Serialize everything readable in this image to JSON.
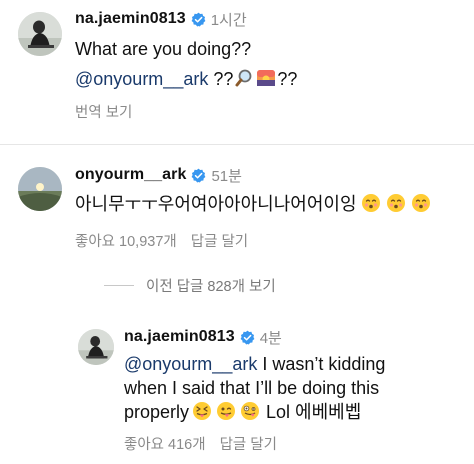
{
  "comment1": {
    "username": "na.jaemin0813",
    "time": "1시간",
    "line1": "What are you doing??",
    "mention": "@onyourm__ark",
    "line2_suffix_a": " ??",
    "line2_suffix_b": "??",
    "translate": "번역 보기",
    "emojis": [
      "magnifying-glass-icon",
      "sunrise-icon"
    ]
  },
  "comment2": {
    "username": "onyourm__ark",
    "time": "51분",
    "text": "아니무ㅜㅜ우어여아아아니나어어이잉",
    "emojis": [
      "kissing-face-icon",
      "kissing-face-icon",
      "kissing-face-icon"
    ],
    "likes": "좋아요 10,937개",
    "reply": "답글 달기"
  },
  "view_previous": "이전 답글 828개 보기",
  "comment3": {
    "username": "na.jaemin0813",
    "time": "4분",
    "mention": "@onyourm__ark",
    "line1_rest": " I wasn’t kidding",
    "line2": "when I said that I’ll be doing this",
    "line3_start": "properly",
    "line3_end": " Lol 에베베벱",
    "emojis": [
      "squinting-tongue-face-icon",
      "winking-tongue-face-icon",
      "zany-face-icon"
    ],
    "likes": "좋아요 416개",
    "reply": "답글 달기"
  },
  "colors": {
    "verified": "#3897f0",
    "mention": "#1a3a6b",
    "muted": "#8a8a8a"
  }
}
